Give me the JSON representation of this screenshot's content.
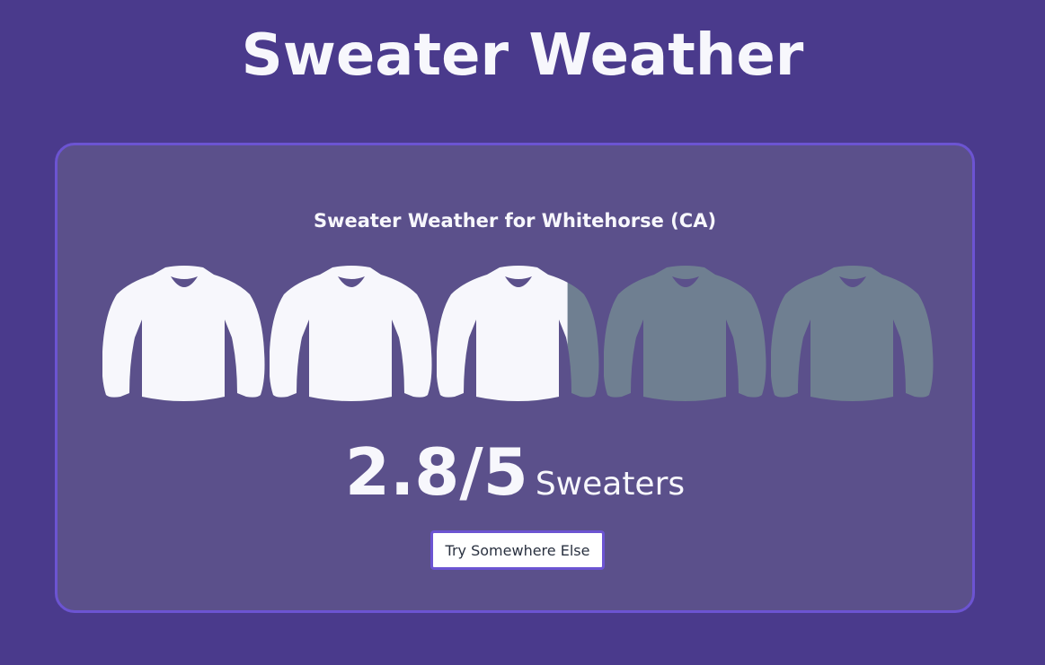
{
  "header": {
    "title": "Sweater Weather"
  },
  "card": {
    "title": "Sweater Weather for Whitehorse (CA)",
    "rating": {
      "value": 2.8,
      "max": 5,
      "score_text": "2.8/5",
      "unit": "Sweaters"
    },
    "button_label": "Try Somewhere Else"
  },
  "icons": {
    "sweater": "sweater-icon"
  },
  "colors": {
    "background": "#4a3a8c",
    "card_background": "#5b508b",
    "card_border": "#6c54d2",
    "sweater_filled": "#f7f7fc",
    "sweater_empty": "#6f7f91",
    "text": "#f7f7fc"
  }
}
